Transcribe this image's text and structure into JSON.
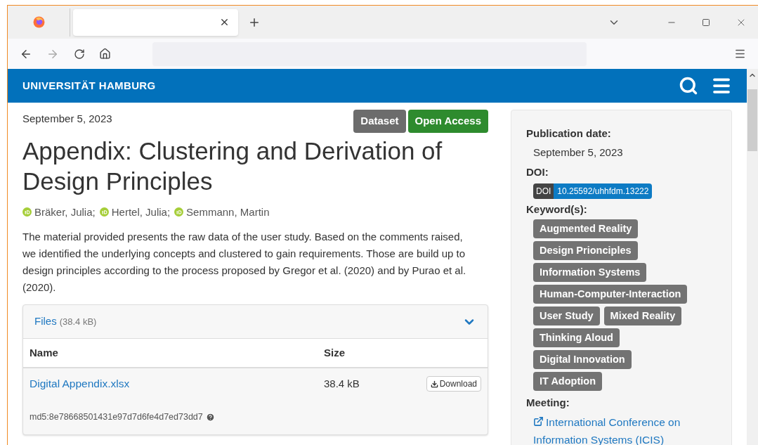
{
  "site": {
    "name": "UNIVERSITÄT HAMBURG"
  },
  "record": {
    "date": "September 5, 2023",
    "badges": [
      {
        "label": "Dataset",
        "color": "#6c6c6c"
      },
      {
        "label": "Open Access",
        "color": "#2e8b2e"
      }
    ],
    "title": "Appendix: Clustering and Derivation of Design Principles",
    "authors": [
      {
        "name": "Bräker, Julia;"
      },
      {
        "name": "Hertel, Julia;"
      },
      {
        "name": "Semmann, Martin"
      }
    ],
    "description": "The material provided presents the raw data of the user study. Based on the comments raised, we identified the underlying concepts and clustered to gain requirements. Those are build up to design principles according to the process proposed by Gregor et al. (2020) and by Purao et al. (2020).",
    "files": {
      "title": "Files",
      "size": "(38.4 kB)",
      "expanded": true,
      "columns": [
        "Name",
        "Size"
      ],
      "rows": [
        {
          "name": "Digital Appendix.xlsx",
          "size": "38.4 kB",
          "action": "Download",
          "checksum": "md5:8e78668501431e97d7d6fe4d7ed73dd7"
        }
      ]
    }
  },
  "sidebar": {
    "publication_label": "Publication date:",
    "publication_date": "September 5, 2023",
    "doi_label": "DOI:",
    "doi_prefix": "DOI",
    "doi": "10.25592/uhhfdm.13222",
    "keywords_label": "Keyword(s):",
    "keywords": [
      [
        "Augmented Reality"
      ],
      [
        "Design Prionciples"
      ],
      [
        "Information Systems"
      ],
      [
        "Human-Computer-Interaction"
      ],
      [
        "User Study",
        "Mixed Reality"
      ],
      [
        "Thinking Aloud"
      ],
      [
        "Digital Innovation"
      ],
      [
        "IT Adoption"
      ]
    ],
    "meeting_label": "Meeting:",
    "meeting": "International Conference on Information Systems (ICIS)"
  }
}
